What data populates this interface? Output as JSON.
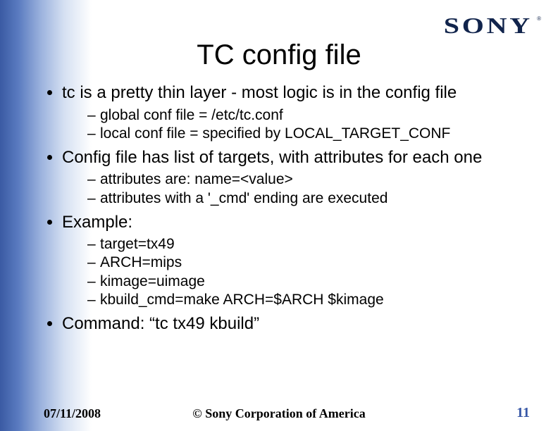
{
  "logo": "SONY",
  "title": "TC config file",
  "bullets": {
    "b1": "tc is a pretty thin layer - most logic is in the config file",
    "b1_sub": [
      "global conf file = /etc/tc.conf",
      "local conf file = specified by LOCAL_TARGET_CONF"
    ],
    "b2": "Config file has list of targets, with attributes for each one",
    "b2_sub": [
      "attributes are: name=<value>",
      "attributes with a '_cmd' ending are executed"
    ],
    "b3": "Example:",
    "b3_sub": [
      "target=tx49",
      "ARCH=mips",
      "kimage=uimage",
      "kbuild_cmd=make ARCH=$ARCH $kimage"
    ],
    "b4": "Command: “tc tx49 kbuild”"
  },
  "footer": {
    "date": "07/11/2008",
    "copyright": "© Sony Corporation of America",
    "page": "11"
  }
}
